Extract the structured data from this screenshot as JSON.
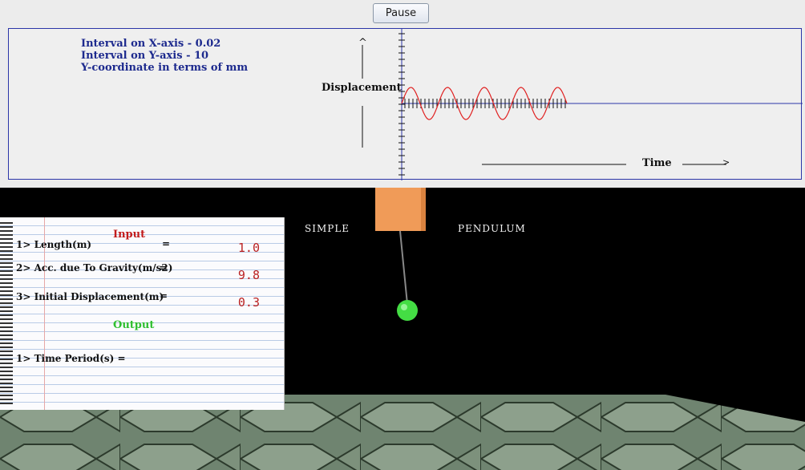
{
  "toolbar": {
    "pause_label": "Pause"
  },
  "graph": {
    "info_lines": [
      "Interval on X-axis - 0.02",
      "Interval on Y-axis - 10",
      "Y-coordinate in terms of mm"
    ],
    "y_axis_label": "Displacement",
    "y_axis_arrow": "^",
    "x_axis_label": "Time",
    "x_axis_arrow": ">"
  },
  "chart_data": {
    "type": "line",
    "title": "",
    "xlabel": "Time",
    "ylabel": "Displacement",
    "series": [
      {
        "color": "#e02020",
        "cycles": 4.5,
        "amplitude": 2
      }
    ]
  },
  "scene": {
    "title_left": "SIMPLE",
    "title_right": "PENDULUM",
    "bob_color": "#44dd44",
    "pivot_color": "#f09b58"
  },
  "notebook": {
    "input_title": "Input",
    "output_title": "Output",
    "inputs": [
      {
        "label": "1> Length(m)",
        "eq": "=",
        "value": "1.0"
      },
      {
        "label": "2> Acc. due To Gravity(m/s2)",
        "eq": "=",
        "value": "9.8"
      },
      {
        "label": "3> Initial Displacement(m)",
        "eq": "=",
        "value": "0.3"
      }
    ],
    "outputs": [
      {
        "label": "1> Time Period(s) ="
      }
    ]
  }
}
